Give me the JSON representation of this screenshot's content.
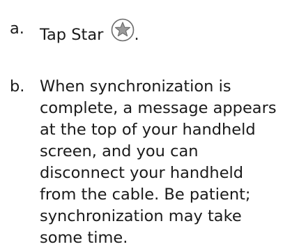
{
  "steps": [
    {
      "letter": "a.",
      "text": "Tap Star",
      "icon": "star-button-icon",
      "suffix": "."
    },
    {
      "letter": "b.",
      "lines": [
        "When synchronization is",
        "complete, a message appears",
        "at the top of your handheld",
        "screen, and you can",
        "disconnect your handheld",
        "from the cable. Be patient;",
        "synchronization may take",
        "some time."
      ]
    }
  ],
  "colors": {
    "text": "#1a1a1a",
    "icon_stroke": "#6a6a6a",
    "icon_fill": "#9a9a9a"
  }
}
